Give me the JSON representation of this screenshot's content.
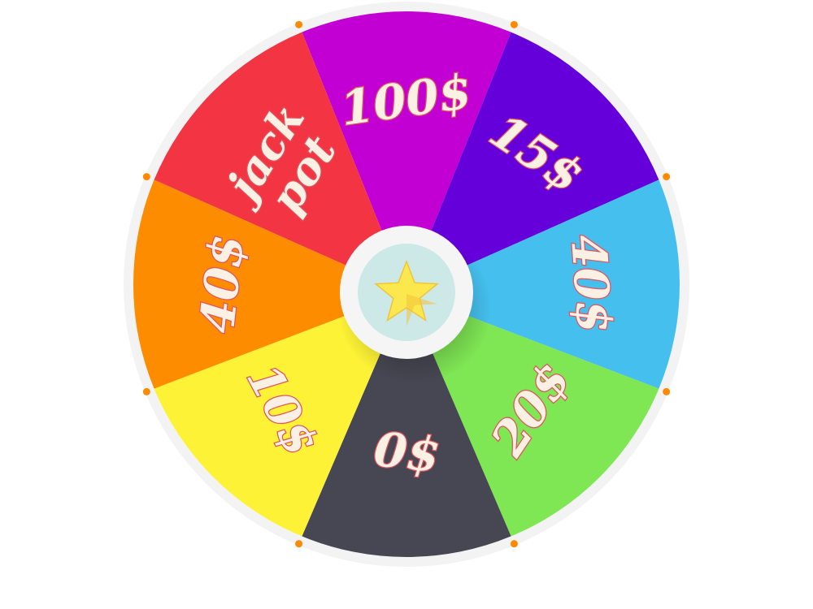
{
  "wheel": {
    "segments": [
      {
        "label": "100$",
        "color": "#c200d4"
      },
      {
        "label": "15$",
        "color": "#6500db"
      },
      {
        "label": "40$",
        "color": "#45c0ee"
      },
      {
        "label": "20$",
        "color": "#7fe654"
      },
      {
        "label": "0$",
        "color": "#464752"
      },
      {
        "label": "10$",
        "color": "#fdf235"
      },
      {
        "label": "40$",
        "color": "#fe8c01"
      },
      {
        "label": "jack pot",
        "color": "#f33543"
      }
    ],
    "rim_color": "#f3f3f3",
    "peg_color": "#ff8a00",
    "hub": {
      "icon": "star-icon",
      "star_color": "#fbe74e",
      "inner_color": "#cce9e8",
      "ring_color": "#f5f5f5"
    }
  }
}
